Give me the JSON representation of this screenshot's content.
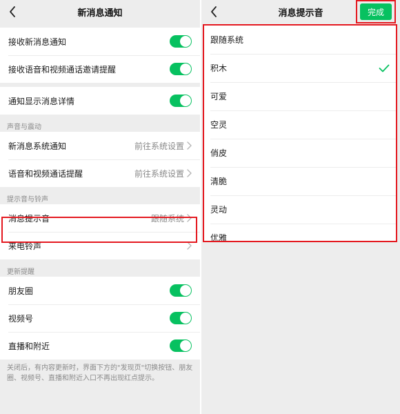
{
  "left": {
    "title": "新消息通知",
    "groups": [
      {
        "items": [
          {
            "label": "接收新消息通知",
            "toggle_on": true
          },
          {
            "label": "接收语音和视频通话邀请提醒",
            "toggle_on": true
          }
        ]
      },
      {
        "items": [
          {
            "label": "通知显示消息详情",
            "toggle_on": true
          }
        ]
      }
    ],
    "sound_vibration": {
      "header": "声音与震动",
      "items": [
        {
          "label": "新消息系统通知",
          "value": "前往系统设置"
        },
        {
          "label": "语音和视频通话提醒",
          "value": "前往系统设置"
        }
      ]
    },
    "tones": {
      "header": "提示音与铃声",
      "items": [
        {
          "label": "消息提示音",
          "value": "跟随系统"
        },
        {
          "label": "来电铃声",
          "value": ""
        }
      ]
    },
    "updates": {
      "header": "更新提醒",
      "items": [
        {
          "label": "朋友圈",
          "toggle_on": true
        },
        {
          "label": "视频号",
          "toggle_on": true
        },
        {
          "label": "直播和附近",
          "toggle_on": true
        }
      ]
    },
    "footnote": "关闭后，有内容更新时，界面下方的\"发现页\"切换按钮、朋友圈、视频号、直播和附近入口不再出现红点提示。"
  },
  "right": {
    "title": "消息提示音",
    "done_label": "完成",
    "options": [
      {
        "label": "跟随系统",
        "selected": false
      },
      {
        "label": "积木",
        "selected": true
      },
      {
        "label": "可爱",
        "selected": false
      },
      {
        "label": "空灵",
        "selected": false
      },
      {
        "label": "俏皮",
        "selected": false
      },
      {
        "label": "清脆",
        "selected": false
      },
      {
        "label": "灵动",
        "selected": false
      },
      {
        "label": "优雅",
        "selected": false
      }
    ]
  },
  "colors": {
    "accent_green": "#07c160",
    "highlight_red": "#e4181f",
    "background": "#ededed"
  },
  "icons": {
    "back": "chevron-left-icon",
    "row_arrow": "chevron-right-icon",
    "selected": "checkmark-icon"
  }
}
